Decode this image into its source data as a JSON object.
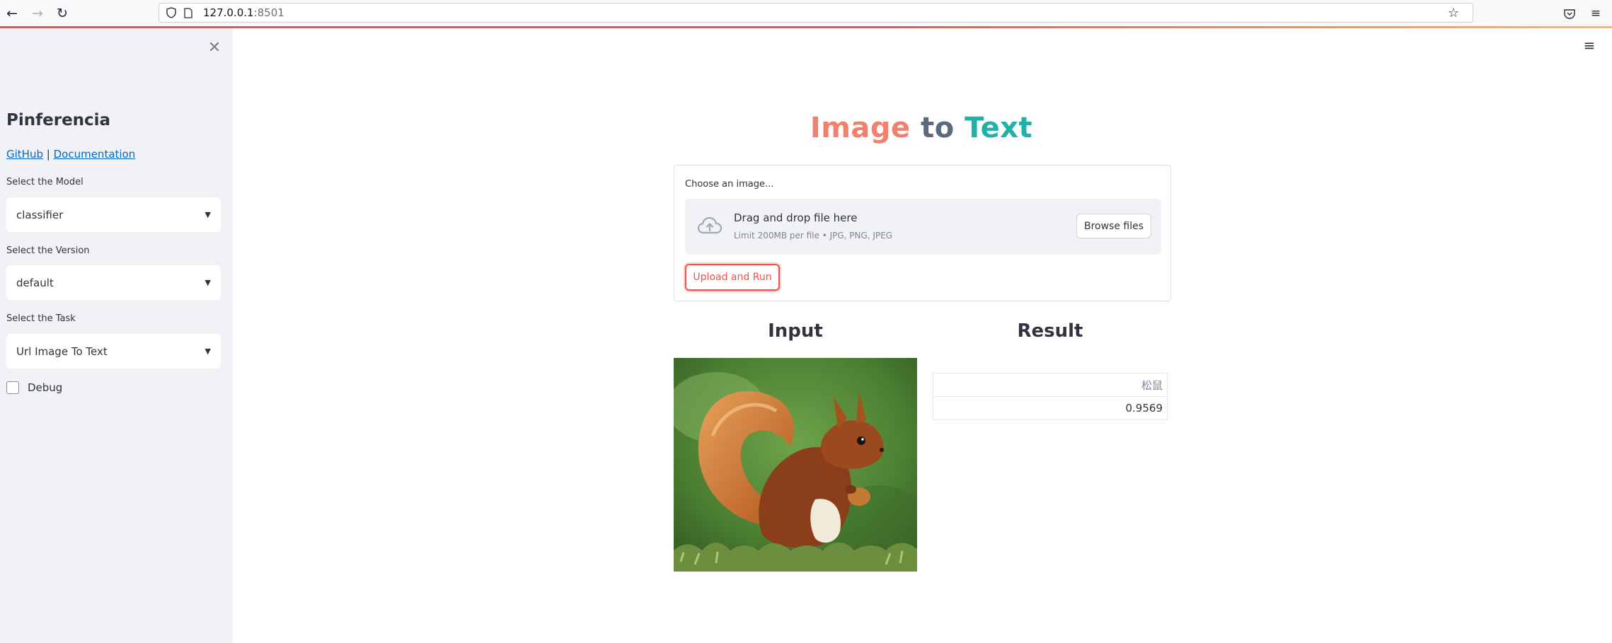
{
  "browser": {
    "url_host": "127.0.0.1",
    "url_port": ":8501"
  },
  "sidebar": {
    "title": "Pinferencia",
    "links": {
      "github": "GitHub",
      "separator": "|",
      "documentation": "Documentation"
    },
    "model": {
      "label": "Select the Model",
      "value": "classifier"
    },
    "version": {
      "label": "Select the Version",
      "value": "default"
    },
    "task": {
      "label": "Select the Task",
      "value": "Url Image To Text"
    },
    "debug": {
      "label": "Debug",
      "checked": false
    }
  },
  "main": {
    "title": {
      "part1": "Image",
      "part2": "to",
      "part3": "Text",
      "colors": {
        "part1": "#f08070",
        "part2": "#5d6a7a",
        "part3": "#20b2aa"
      }
    },
    "uploader": {
      "label": "Choose an image...",
      "drop_text": "Drag and drop file here",
      "limit_text": "Limit 200MB per file • JPG, PNG, JPEG",
      "browse_label": "Browse files",
      "icon": "cloud-upload-icon"
    },
    "run_button": "Upload and Run",
    "input_heading": "Input",
    "result_heading": "Result",
    "result_table": {
      "header": "松鼠",
      "value": "0.9569"
    }
  },
  "colors": {
    "primary": "#ff4b4b",
    "sidebar_bg": "#f0f2f6",
    "text": "#31333f"
  }
}
